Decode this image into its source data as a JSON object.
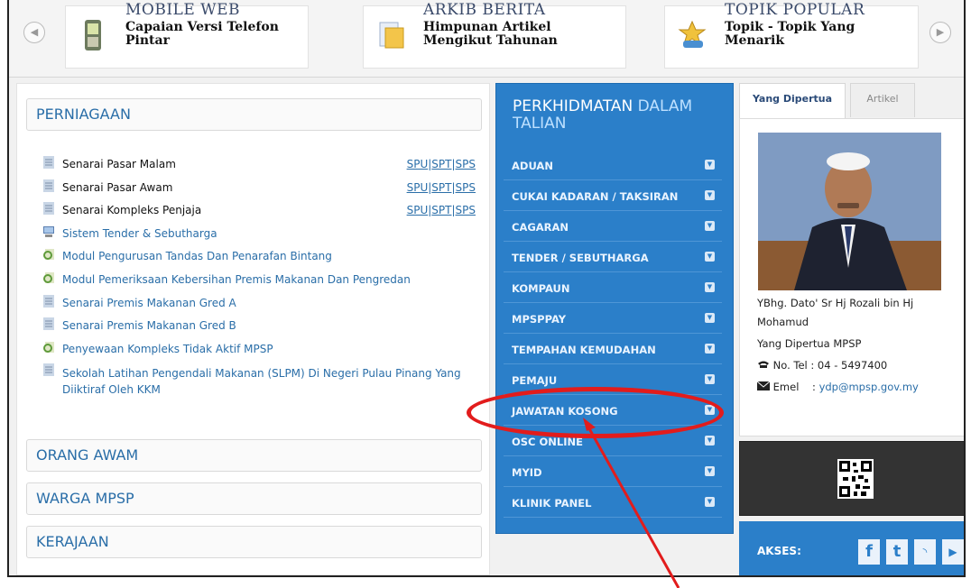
{
  "carousel": {
    "items": [
      {
        "title": "MOBILE WEB",
        "line1": "Capaian Versi Telefon",
        "line2": "Pintar",
        "icon": "phone-icon"
      },
      {
        "title": "ARKIB BERITA",
        "line1": "Himpunan Artikel",
        "line2": "Mengikut Tahunan",
        "icon": "folder-icon"
      },
      {
        "title": "TOPIK POPULAR",
        "line1": "Topik - Topik Yang",
        "line2": "Menarik",
        "icon": "handshake-icon"
      }
    ],
    "prev_glyph": "◀",
    "next_glyph": "▶"
  },
  "left_panel": {
    "sections": [
      "PERNIAGAAN",
      "ORANG AWAM",
      "WARGA MPSP",
      "KERAJAAN"
    ],
    "items": [
      {
        "text": "Senarai Pasar Malam",
        "color": "black",
        "icon": "document-icon",
        "links": [
          "SPU",
          "SPT",
          "SPS"
        ]
      },
      {
        "text": "Senarai Pasar Awam",
        "color": "black",
        "icon": "document-icon",
        "links": [
          "SPU",
          "SPT",
          "SPS"
        ]
      },
      {
        "text": "Senarai Kompleks Penjaja",
        "color": "black",
        "icon": "document-icon",
        "links": [
          "SPU",
          "SPT",
          "SPS"
        ]
      },
      {
        "text": "Sistem Tender & Sebutharga",
        "color": "blue",
        "icon": "computer-icon"
      },
      {
        "text": "Modul Pengurusan Tandas Dan Penarafan Bintang",
        "color": "blue",
        "icon": "search-document-icon"
      },
      {
        "text": "Modul Pemeriksaan Kebersihan Premis Makanan Dan Pengredan",
        "color": "blue",
        "icon": "search-document-icon"
      },
      {
        "text": "Senarai Premis Makanan Gred A",
        "color": "blue",
        "icon": "document-icon"
      },
      {
        "text": "Senarai Premis Makanan Gred B",
        "color": "blue",
        "icon": "document-icon"
      },
      {
        "text": "Penyewaan Kompleks Tidak Aktif MPSP",
        "color": "blue",
        "icon": "search-document-icon"
      },
      {
        "text": "Sekolah Latihan Pengendali Makanan (SLPM) Di Negeri Pulau Pinang Yang Diiktiraf Oleh KKM",
        "color": "blue",
        "icon": "document-icon"
      }
    ],
    "link_separator": "|"
  },
  "services": {
    "title_a": "PERKHIDMATAN",
    "title_b": "DALAM TALIAN",
    "items": [
      "ADUAN",
      "CUKAI KADARAN / TAKSIRAN",
      "CAGARAN",
      "TENDER / SEBUTHARGA",
      "KOMPAUN",
      "MPSPPAY",
      "TEMPAHAN KEMUDAHAN",
      "PEMAJU",
      "JAWATAN KOSONG",
      "OSC ONLINE",
      "MYID",
      "KLINIK PANEL"
    ],
    "chevron_glyph": "▼"
  },
  "profile": {
    "tabs": [
      "Yang Dipertua",
      "Artikel"
    ],
    "name_line1": "YBhg. Dato' Sr Hj Rozali bin Hj",
    "name_line2": "Mohamud",
    "position": "Yang Dipertua MPSP",
    "phone_label": "No. Tel",
    "phone": ": 04 - 5497400",
    "email_label": "Emel",
    "email_sep": ":",
    "email": "ydp@mpsp.gov.my"
  },
  "akses": {
    "label": "AKSES:",
    "social": [
      {
        "glyph": "f",
        "icon": "facebook-icon"
      },
      {
        "glyph": "t",
        "icon": "twitter-icon"
      },
      {
        "glyph": "◝",
        "icon": "rss-icon"
      },
      {
        "glyph": "▶",
        "icon": "youtube-icon"
      }
    ]
  },
  "colors": {
    "accent_blue": "#2b7fc9",
    "link_blue": "#2a6ea8",
    "annotation_red": "#e21c1c"
  }
}
